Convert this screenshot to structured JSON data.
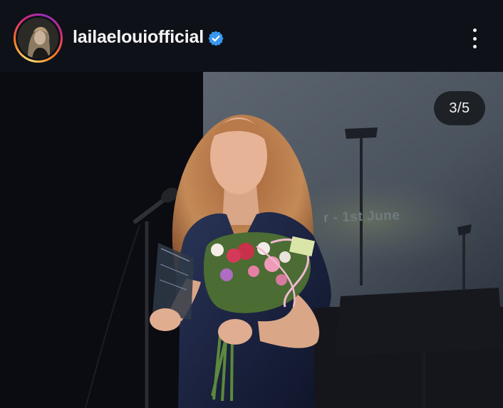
{
  "header": {
    "username": "lailaelouiofficial",
    "verified": true,
    "avatar_icon": "profile-avatar",
    "more_icon": "more-vertical-icon"
  },
  "carousel": {
    "counter": "3/5",
    "current": 3,
    "total": 5
  },
  "photo": {
    "screen_text": "r - 1st June"
  },
  "colors": {
    "header_bg": "#0e1117",
    "verified_blue": "#3897f0",
    "ring_start": "#feda75",
    "ring_end": "#962fbf"
  }
}
